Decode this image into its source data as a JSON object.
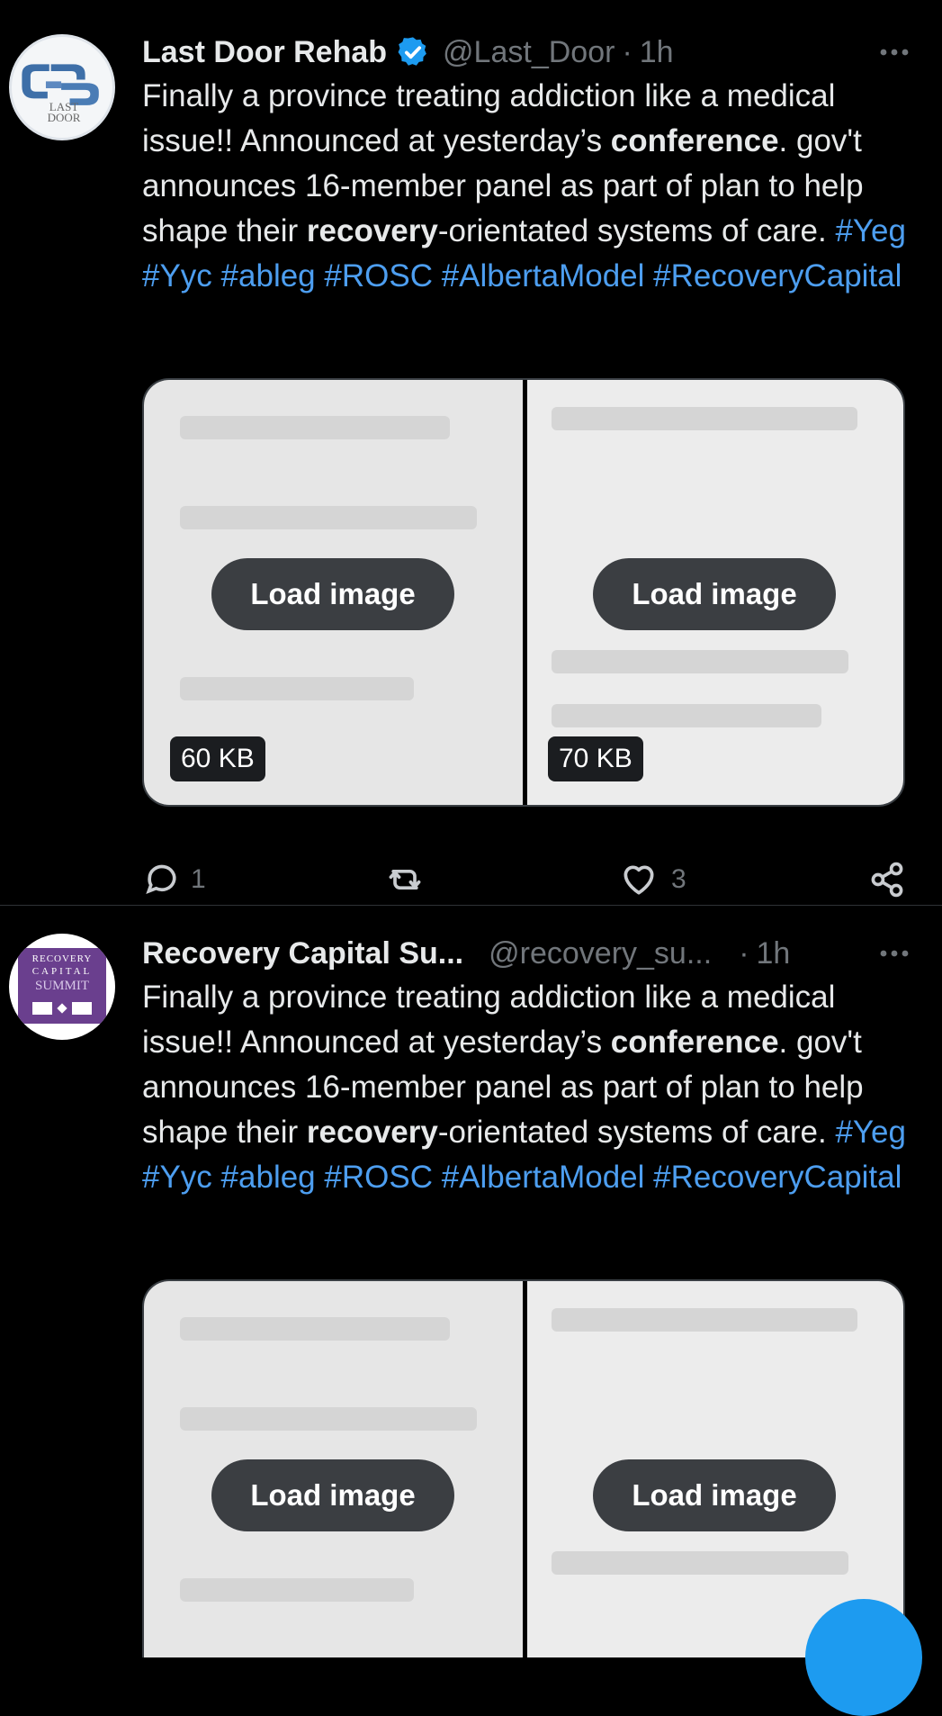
{
  "tweets": [
    {
      "author": "Last Door Rehab",
      "handle": "@Last_Door",
      "time": "1h",
      "avatar_text": "LAST DOOR",
      "text_parts": [
        {
          "t": "Finally a province treating addiction like a medical issue!! Announced at yesterday’s ",
          "s": "plain"
        },
        {
          "t": "conference",
          "s": "bold"
        },
        {
          "t": ". gov't announces 16-member panel as part of plan to help shape their ",
          "s": "plain"
        },
        {
          "t": "recovery",
          "s": "bold"
        },
        {
          "t": "-orientated systems of care. ",
          "s": "plain"
        },
        {
          "t": "#Yeg",
          "s": "tag"
        },
        {
          "t": " ",
          "s": "plain"
        },
        {
          "t": "#Yyc",
          "s": "tag"
        },
        {
          "t": " ",
          "s": "plain"
        },
        {
          "t": "#ableg",
          "s": "tag"
        },
        {
          "t": " ",
          "s": "plain"
        },
        {
          "t": "#ROSC",
          "s": "tag"
        },
        {
          "t": " ",
          "s": "plain"
        },
        {
          "t": "#AlbertaModel",
          "s": "tag"
        },
        {
          "t": " ",
          "s": "plain"
        },
        {
          "t": "#RecoveryCapital",
          "s": "tag"
        }
      ],
      "media": [
        {
          "label": "Load image",
          "size": "60 KB"
        },
        {
          "label": "Load image",
          "size": "70 KB"
        }
      ],
      "replies": "1",
      "likes": "3"
    },
    {
      "author": "Recovery Capital Su...",
      "handle": "@recovery_su...",
      "time": "1h",
      "avatar_lines": [
        "RECOVERY",
        "CAPITAL",
        "SUMMIT"
      ],
      "text_parts": [
        {
          "t": "Finally a province treating addiction like a medical issue!! Announced at yesterday’s ",
          "s": "plain"
        },
        {
          "t": "conference",
          "s": "bold"
        },
        {
          "t": ". gov't announces 16-member panel as part of plan to help shape their ",
          "s": "plain"
        },
        {
          "t": "recovery",
          "s": "bold"
        },
        {
          "t": "-orientated systems of care. ",
          "s": "plain"
        },
        {
          "t": "#Yeg",
          "s": "tag"
        },
        {
          "t": " ",
          "s": "plain"
        },
        {
          "t": "#Yyc",
          "s": "tag"
        },
        {
          "t": " ",
          "s": "plain"
        },
        {
          "t": "#ableg",
          "s": "tag"
        },
        {
          "t": " ",
          "s": "plain"
        },
        {
          "t": "#ROSC",
          "s": "tag"
        },
        {
          "t": " ",
          "s": "plain"
        },
        {
          "t": "#AlbertaModel",
          "s": "tag"
        },
        {
          "t": " ",
          "s": "plain"
        },
        {
          "t": "#RecoveryCapital",
          "s": "tag"
        }
      ],
      "media": [
        {
          "label": "Load image"
        },
        {
          "label": "Load image"
        }
      ]
    }
  ],
  "colors": {
    "background": "#000000",
    "hashtag": "#4d9ef0",
    "muted": "#71767b",
    "verified": "#1d9bf0"
  }
}
